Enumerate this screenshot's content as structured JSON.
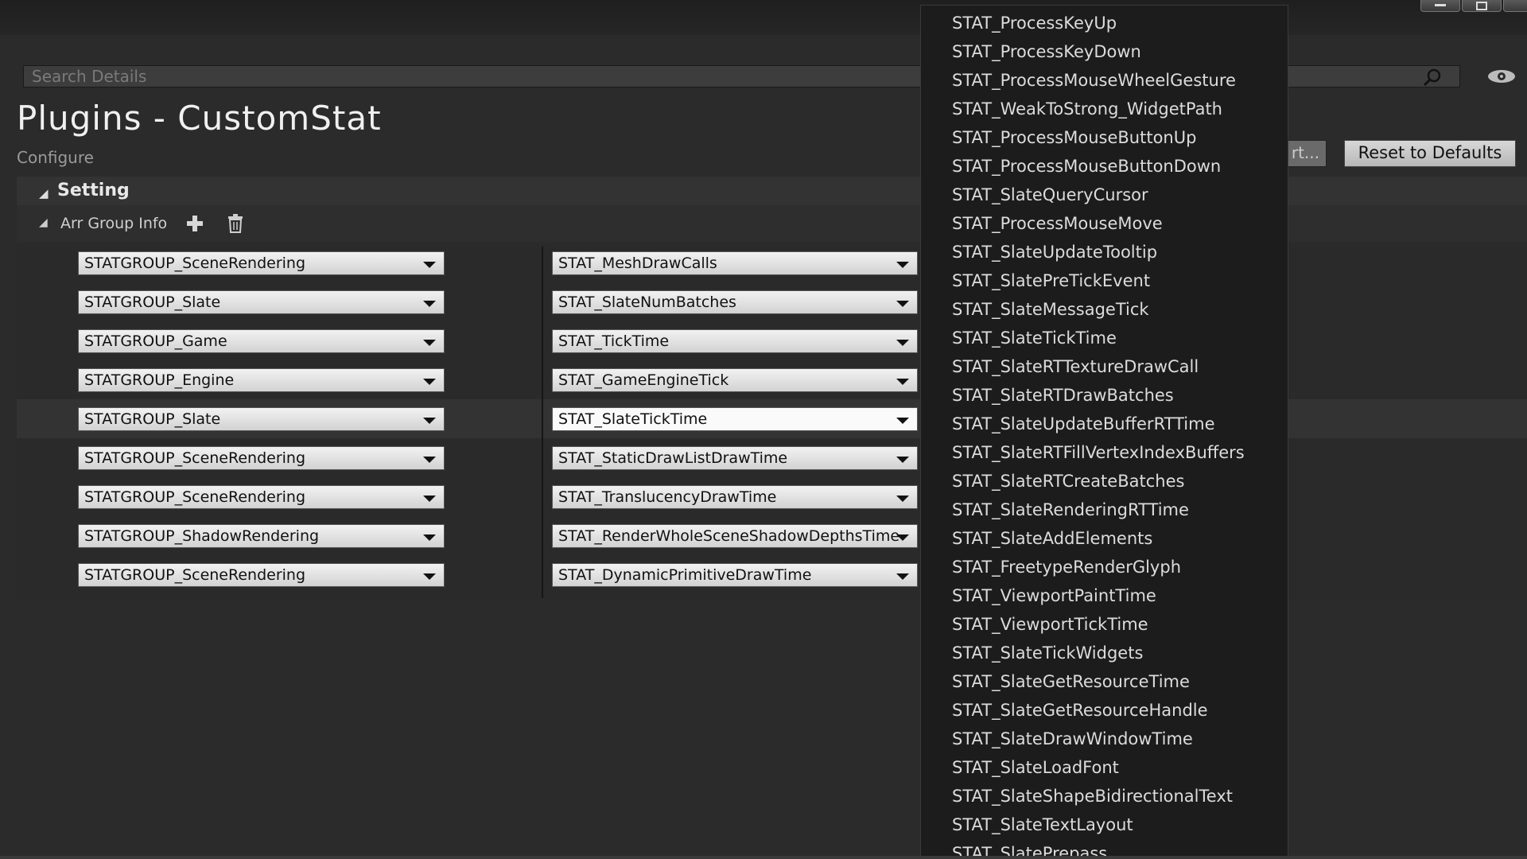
{
  "window": {
    "minimize_icon": "minimize-icon",
    "maximize_icon": "maximize-icon",
    "close_icon": "close-icon"
  },
  "search": {
    "placeholder": "Search Details",
    "value": ""
  },
  "header": {
    "title": "Plugins - CustomStat",
    "subtitle": "Configure"
  },
  "actions": {
    "export_label": "rt...",
    "reset_label": "Reset to Defaults"
  },
  "setting": {
    "label": "Setting"
  },
  "arr_group": {
    "label": "Arr Group Info"
  },
  "rows": [
    {
      "group": "STATGROUP_SceneRendering",
      "stat": "STAT_MeshDrawCalls"
    },
    {
      "group": "STATGROUP_Slate",
      "stat": "STAT_SlateNumBatches"
    },
    {
      "group": "STATGROUP_Game",
      "stat": "STAT_TickTime"
    },
    {
      "group": "STATGROUP_Engine",
      "stat": "STAT_GameEngineTick"
    },
    {
      "group": "STATGROUP_Slate",
      "stat": "STAT_SlateTickTime"
    },
    {
      "group": "STATGROUP_SceneRendering",
      "stat": "STAT_StaticDrawListDrawTime"
    },
    {
      "group": "STATGROUP_SceneRendering",
      "stat": "STAT_TranslucencyDrawTime"
    },
    {
      "group": "STATGROUP_ShadowRendering",
      "stat": "STAT_RenderWholeSceneShadowDepthsTime"
    },
    {
      "group": "STATGROUP_SceneRendering",
      "stat": "STAT_DynamicPrimitiveDrawTime"
    }
  ],
  "dropdown_options": [
    "STAT_ProcessKeyUp",
    "STAT_ProcessKeyDown",
    "STAT_ProcessMouseWheelGesture",
    "STAT_WeakToStrong_WidgetPath",
    "STAT_ProcessMouseButtonUp",
    "STAT_ProcessMouseButtonDown",
    "STAT_SlateQueryCursor",
    "STAT_ProcessMouseMove",
    "STAT_SlateUpdateTooltip",
    "STAT_SlatePreTickEvent",
    "STAT_SlateMessageTick",
    "STAT_SlateTickTime",
    "STAT_SlateRTTextureDrawCall",
    "STAT_SlateRTDrawBatches",
    "STAT_SlateUpdateBufferRTTime",
    "STAT_SlateRTFillVertexIndexBuffers",
    "STAT_SlateRTCreateBatches",
    "STAT_SlateRenderingRTTime",
    "STAT_SlateAddElements",
    "STAT_FreetypeRenderGlyph",
    "STAT_ViewportPaintTime",
    "STAT_ViewportTickTime",
    "STAT_SlateTickWidgets",
    "STAT_SlateGetResourceTime",
    "STAT_SlateGetResourceHandle",
    "STAT_SlateDrawWindowTime",
    "STAT_SlateLoadFont",
    "STAT_SlateShapeBidirectionalText",
    "STAT_SlateTextLayout",
    "STAT_SlatePrepass"
  ]
}
